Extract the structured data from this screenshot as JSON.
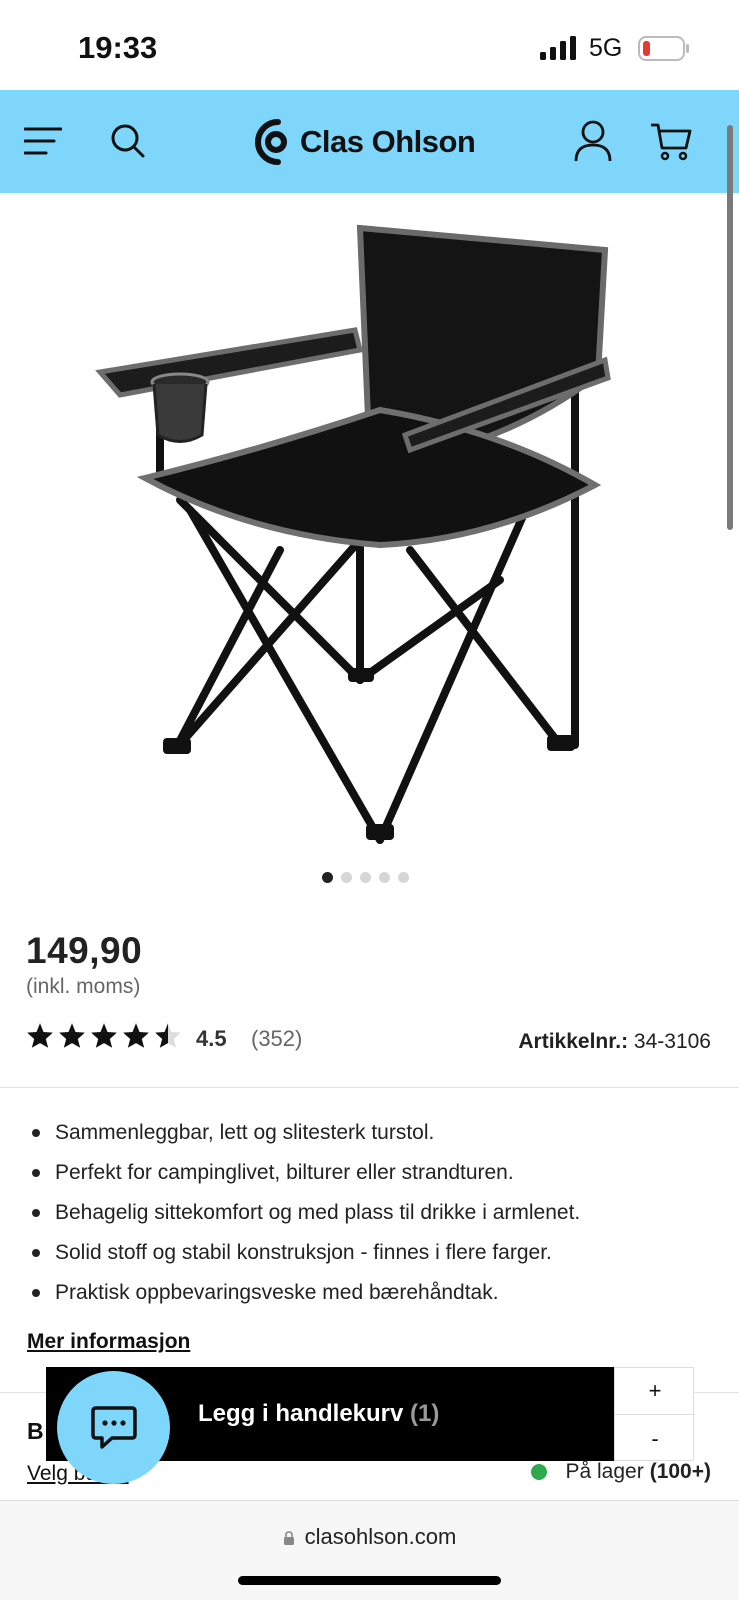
{
  "status_bar": {
    "time": "19:33",
    "network": "5G",
    "battery_color": "#e53935"
  },
  "header": {
    "background": "#7ed6fb",
    "brand_name": "Clas Ohlson",
    "icons": [
      "menu-icon",
      "search-icon",
      "brand-logo",
      "account-icon",
      "cart-icon"
    ]
  },
  "gallery": {
    "image_count": 5,
    "active_index": 0,
    "image_description_icon": "folding-chair-image"
  },
  "product": {
    "price": "149,90",
    "vat_note": "(inkl. moms)",
    "rating": {
      "value": "4.5",
      "count": "(352)",
      "stars_filled": 4.5,
      "stars_total": 5
    },
    "article": {
      "label": "Artikkelnr.:",
      "number": "34-3106"
    },
    "features": [
      "Sammenleggbar, lett og slitesterk turstol.",
      "Perfekt for campinglivet, bilturer eller strandturen.",
      "Behagelig sittekomfort og med plass til drikke i armlenet.",
      "Solid stoff og stabil konstruksjon - finnes i flere farger.",
      "Praktisk oppbevaringsveske med bærehåndtak."
    ],
    "more_info_label": "Mer informasjon"
  },
  "store": {
    "section_heading": "B",
    "store_link": "Velg butikk",
    "stock_label": "På lager",
    "stock_count": "(100+)",
    "stock_color": "#2eaa4c"
  },
  "cart": {
    "add_label": "Legg i handlekurv",
    "quantity": "(1)",
    "plus_label": "+",
    "minus_label": "-"
  },
  "browser": {
    "url": "clasohlson.com"
  }
}
